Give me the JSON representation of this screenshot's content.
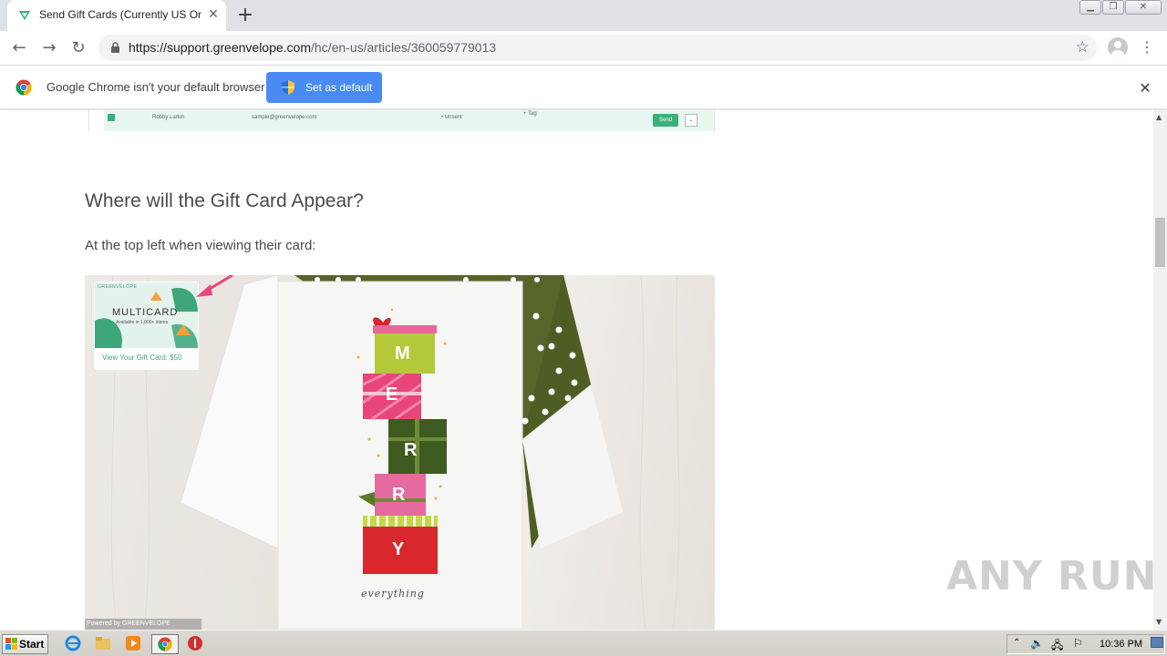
{
  "browser": {
    "tab_title": "Send Gift Cards (Currently US Only)",
    "url_host": "https://support.greenvelope.com",
    "url_path": "/hc/en-us/articles/360059779013"
  },
  "infobar": {
    "message": "Google Chrome isn't your default browser",
    "set_default_label": "Set as default"
  },
  "article": {
    "previous_row": {
      "name": "Robby Larkin",
      "email": "sample@greenvelope.com",
      "status": "• Unsent",
      "tag": "+ Tag",
      "send_label": "Send"
    },
    "heading": "Where will the Gift Card Appear?",
    "paragraph": "At the top left when viewing their card:",
    "card_image": {
      "brand_small": "GREENVELOPE",
      "gift_card_title": "MULTICARD",
      "gift_card_subtitle": "Available in 1,000+ stores",
      "gift_card_link": "View Your Gift Card: $50",
      "stack_letters": [
        "M",
        "E",
        "R",
        "R",
        "Y"
      ],
      "script_text": "everything",
      "powered_by": "Powered by GREENVELOPE"
    }
  },
  "watermark": "ANY RUN",
  "taskbar": {
    "start_label": "Start",
    "clock": "10:36 PM"
  },
  "colors": {
    "tab_strip": "#dee1e6",
    "primary_button": "#4a8af4",
    "green_envelope": "#56652a",
    "accent_pink": "#e8477e"
  }
}
